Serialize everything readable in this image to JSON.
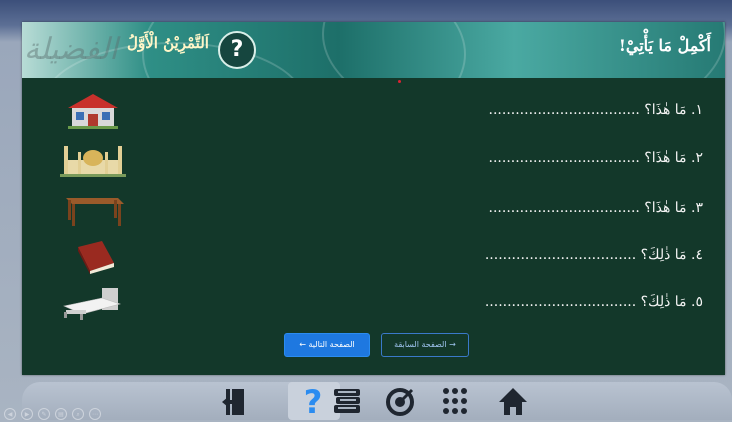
{
  "header": {
    "instruction": "أَكْمِلْ مَا يَأْتِيْ!",
    "exercise_title": "اَلتَّمْرِيْنُ الْأَوَّلُ",
    "help_symbol": "?",
    "calligraphy_text": "الفضيلة",
    "help_icon": "question-mark-icon"
  },
  "questions": [
    {
      "text": "١. مَا هٰذَا؟ ..................................",
      "picture": "house-icon"
    },
    {
      "text": "٢. مَا هٰذَا؟ ..................................",
      "picture": "mosque-icon"
    },
    {
      "text": "٣. مَا هٰذَا؟ ..................................",
      "picture": "table-icon"
    },
    {
      "text": "٤. مَا ذٰلِكَ؟ ..................................",
      "picture": "book-icon"
    },
    {
      "text": "٥. مَا ذٰلِكَ؟ ..................................",
      "picture": "bed-icon"
    }
  ],
  "navigation": {
    "next_label": "الصفحة التالية ←",
    "prev_label": "→ الصفحة السابقة"
  },
  "toolbar": {
    "items": [
      "exit-door-icon",
      "question-mark-icon",
      "books-icon",
      "target-icon",
      "grid-menu-icon",
      "home-icon"
    ],
    "active": "question-mark-icon"
  },
  "mini_controls": [
    "back-icon",
    "forward-icon",
    "edit-icon",
    "print-icon",
    "zoom-icon",
    "more-icon"
  ],
  "colors": {
    "panel_background": "#13382a",
    "header_teal": "#1d6f69",
    "accent_blue": "#1e78e0",
    "toolbar": "#a9b4c2"
  }
}
